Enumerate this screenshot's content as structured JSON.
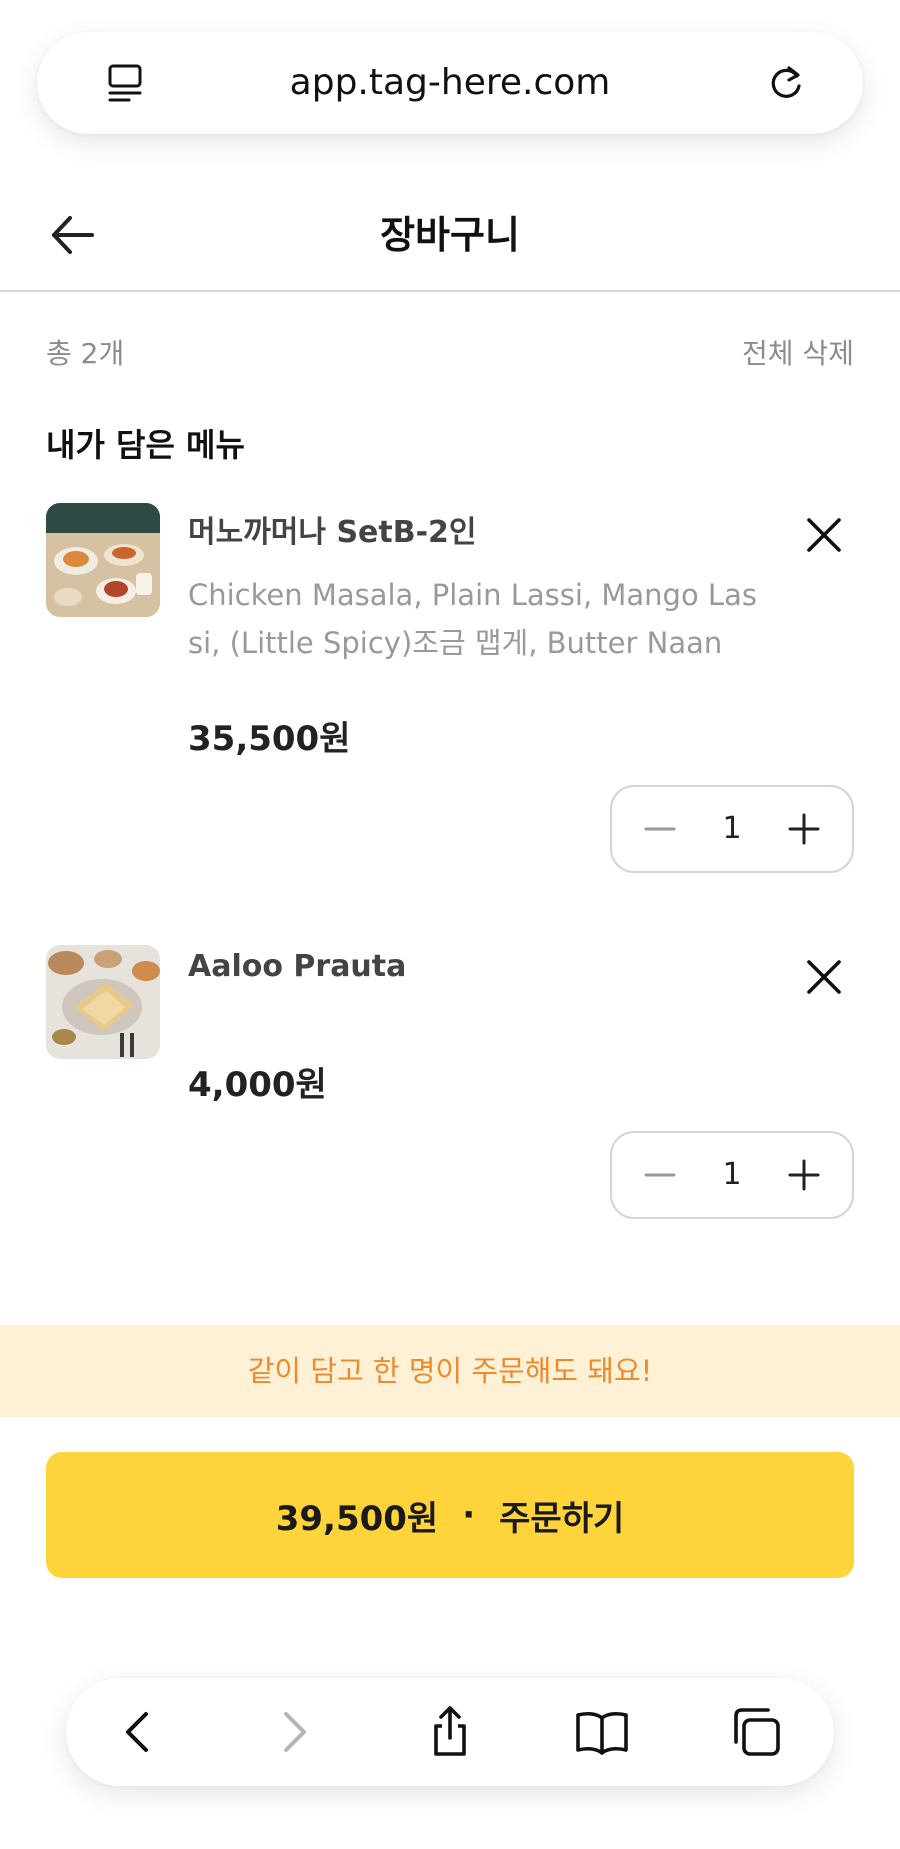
{
  "browser": {
    "url": "app.tag-here.com"
  },
  "header": {
    "title": "장바구니"
  },
  "summary": {
    "count": "총 2개",
    "clear_all": "전체 삭제"
  },
  "section_title": "내가 담은 메뉴",
  "items": [
    {
      "name": "머노까머나 SetB-2인",
      "options_line1": "Chicken Masala, Plain Lassi, Mango Las",
      "options_line2": "si, (Little Spicy)조금 맵게, Butter Naan",
      "price": "35,500원",
      "quantity": "1"
    },
    {
      "name": "Aaloo Prauta",
      "price": "4,000원",
      "quantity": "1"
    }
  ],
  "notice": "같이 담고 한 명이 주문해도 돼요!",
  "order": {
    "total": "39,500원",
    "separator": "·",
    "label": "주문하기"
  },
  "colors": {
    "accent": "#ffd43b",
    "notice_bg": "#fff1d6",
    "notice_text": "#ef8a2c"
  },
  "icons": [
    "reader-icon",
    "reload-icon",
    "back-arrow-icon",
    "close-icon",
    "minus-icon",
    "plus-icon",
    "back-icon",
    "forward-icon",
    "share-icon",
    "bookmarks-icon",
    "tabs-icon"
  ]
}
